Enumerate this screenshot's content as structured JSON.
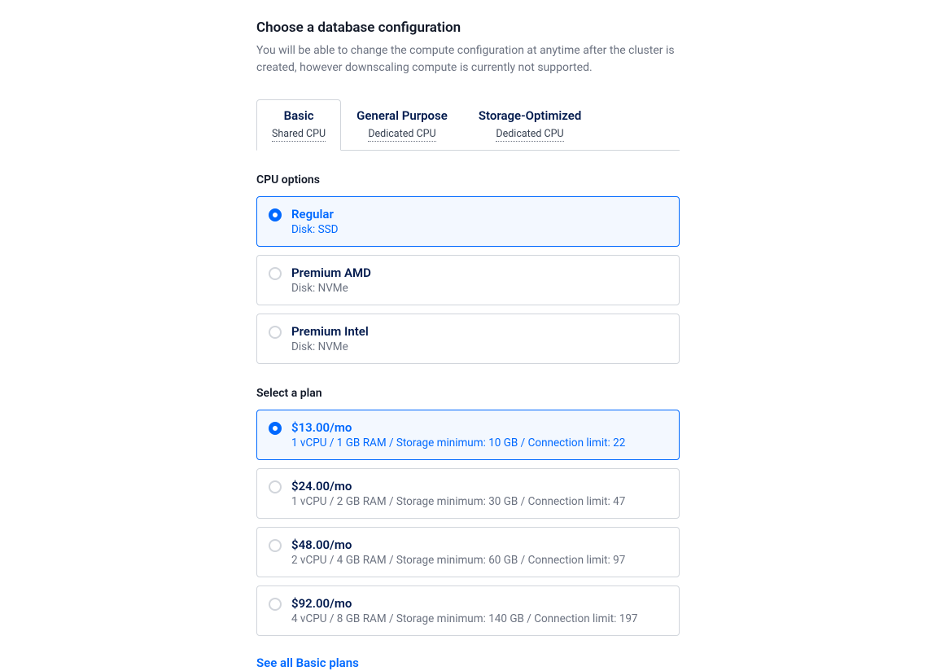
{
  "header": {
    "title": "Choose a database configuration",
    "subtitle": "You will be able to change the compute configuration at anytime after the cluster is created, however downscaling compute is currently not supported."
  },
  "tabs": [
    {
      "title": "Basic",
      "subtitle": "Shared CPU",
      "active": true
    },
    {
      "title": "General Purpose",
      "subtitle": "Dedicated CPU",
      "active": false
    },
    {
      "title": "Storage-Optimized",
      "subtitle": "Dedicated CPU",
      "active": false
    }
  ],
  "cpu_options": {
    "label": "CPU options",
    "items": [
      {
        "title": "Regular",
        "desc": "Disk: SSD",
        "selected": true
      },
      {
        "title": "Premium AMD",
        "desc": "Disk: NVMe",
        "selected": false
      },
      {
        "title": "Premium Intel",
        "desc": "Disk: NVMe",
        "selected": false
      }
    ]
  },
  "plans": {
    "label": "Select a plan",
    "items": [
      {
        "price": "$13.00/mo",
        "details": "1 vCPU / 1 GB RAM / Storage minimum: 10 GB / Connection limit: 22",
        "selected": true
      },
      {
        "price": "$24.00/mo",
        "details": "1 vCPU / 2 GB RAM / Storage minimum: 30 GB / Connection limit: 47",
        "selected": false
      },
      {
        "price": "$48.00/mo",
        "details": "2 vCPU / 4 GB RAM / Storage minimum: 60 GB / Connection limit: 97",
        "selected": false
      },
      {
        "price": "$92.00/mo",
        "details": "4 vCPU / 8 GB RAM / Storage minimum: 140 GB / Connection limit: 197",
        "selected": false
      }
    ]
  },
  "link": {
    "label": "See all Basic plans"
  }
}
